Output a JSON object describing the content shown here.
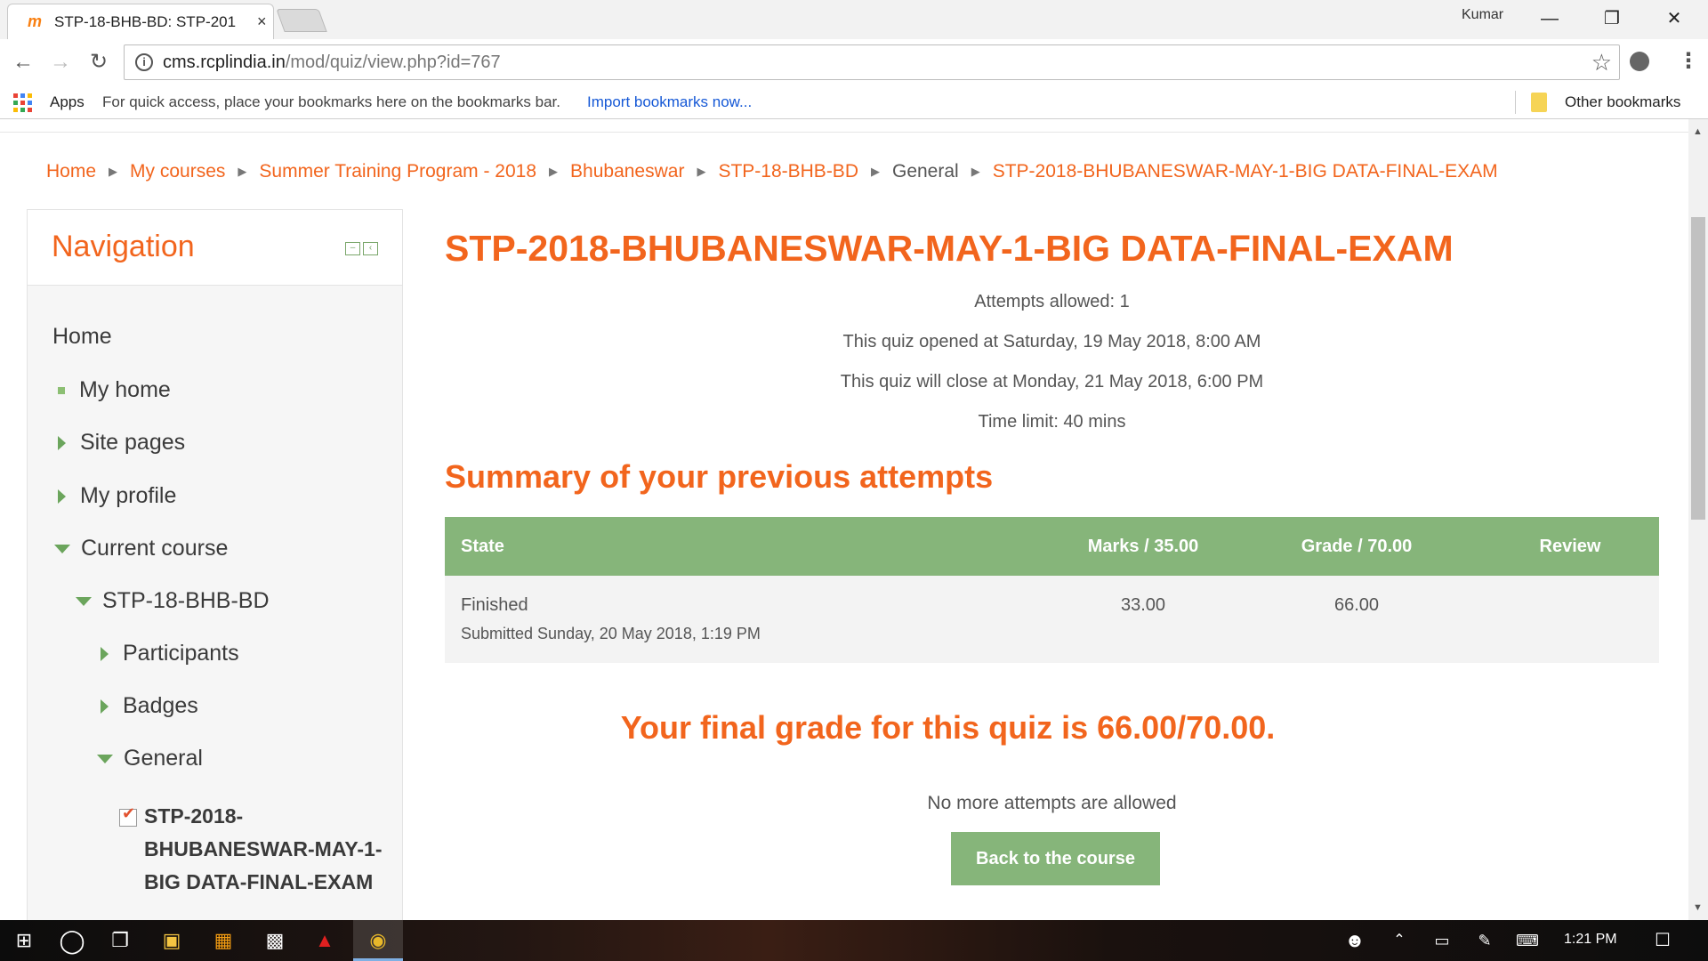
{
  "browser": {
    "tab_title": "STP-18-BHB-BD: STP-201",
    "tab_close": "×",
    "favicon": "m",
    "profile": "Kumar",
    "url_host": "cms.rcplindia.in",
    "url_path": "/mod/quiz/view.php?id=767",
    "bookmarks": {
      "apps": "Apps",
      "hint": "For quick access, place your bookmarks here on the bookmarks bar.",
      "import": "Import bookmarks now...",
      "other": "Other bookmarks"
    }
  },
  "breadcrumb": [
    "Home",
    "My courses",
    "Summer Training Program - 2018",
    "Bhubaneswar",
    "STP-18-BHB-BD",
    "General",
    "STP-2018-BHUBANESWAR-MAY-1-BIG DATA-FINAL-EXAM"
  ],
  "navigation": {
    "title": "Navigation",
    "items": {
      "home": "Home",
      "my_home": "My home",
      "site_pages": "Site pages",
      "my_profile": "My profile",
      "current_course": "Current course",
      "course": "STP-18-BHB-BD",
      "participants": "Participants",
      "badges": "Badges",
      "general": "General",
      "quiz": "STP-2018-BHUBANESWAR-MAY-1-BIG DATA-FINAL-EXAM"
    }
  },
  "quiz": {
    "title": "STP-2018-BHUBANESWAR-MAY-1-BIG DATA-FINAL-EXAM",
    "attempts_allowed": "Attempts allowed: 1",
    "opened": "This quiz opened at Saturday, 19 May 2018, 8:00 AM",
    "closes": "This quiz will close at Monday, 21 May 2018, 6:00 PM",
    "time_limit": "Time limit: 40 mins",
    "summary_heading": "Summary of your previous attempts",
    "table": {
      "headers": [
        "State",
        "Marks / 35.00",
        "Grade / 70.00",
        "Review"
      ],
      "row": {
        "state": "Finished",
        "submitted": "Submitted Sunday, 20 May 2018, 1:19 PM",
        "marks": "33.00",
        "grade": "66.00",
        "review": ""
      }
    },
    "final_grade": "Your final grade for this quiz is 66.00/70.00.",
    "no_more": "No more attempts are allowed",
    "back_button": "Back to the course"
  },
  "taskbar": {
    "clock": "1:21 PM"
  },
  "colors": {
    "accent": "#f2651d",
    "green": "#86b57a"
  }
}
